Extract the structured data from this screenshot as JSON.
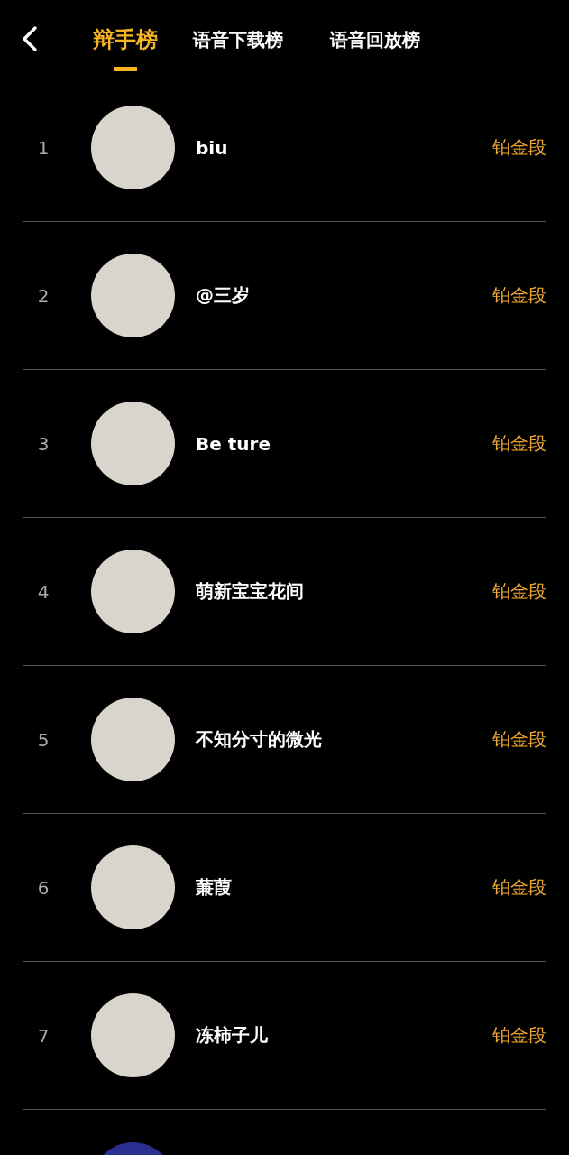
{
  "header": {
    "tabs": [
      {
        "label": "辩手榜",
        "selected": true
      },
      {
        "label": "语音下载榜",
        "selected": false
      },
      {
        "label": "语音回放榜",
        "selected": false
      }
    ]
  },
  "rows": [
    {
      "kind": "entry",
      "rank": "1",
      "name": "biu",
      "tier": "铂金段"
    },
    {
      "kind": "entry",
      "rank": "2",
      "name": "@三岁",
      "tier": "铂金段"
    },
    {
      "kind": "entry",
      "rank": "3",
      "name": "Be ture",
      "tier": "铂金段"
    },
    {
      "kind": "entry",
      "rank": "4",
      "name": "萌新宝宝花间",
      "tier": "铂金段"
    },
    {
      "kind": "entry",
      "rank": "5",
      "name": "不知分寸的微光",
      "tier": "铂金段"
    },
    {
      "kind": "entry",
      "rank": "6",
      "name": "蒹葭",
      "tier": "铂金段"
    },
    {
      "kind": "entry",
      "rank": "7",
      "name": "冻柿子儿",
      "tier": "铂金段"
    },
    {
      "kind": "partial"
    }
  ]
}
